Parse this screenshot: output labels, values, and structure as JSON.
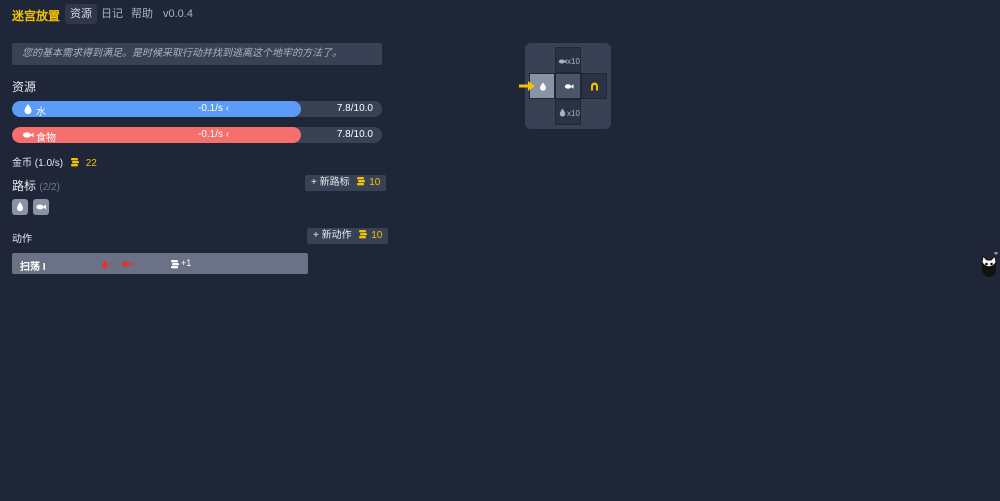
{
  "app": {
    "title": "迷宫放置"
  },
  "nav": [
    {
      "label": "资源",
      "active": true
    },
    {
      "label": "日记",
      "active": false
    },
    {
      "label": "帮助",
      "active": false
    },
    {
      "label": "v0.0.4",
      "active": false
    }
  ],
  "message": "您的基本需求得到满足。是时候采取行动并找到逃离这个地牢的方法了。",
  "resources": {
    "heading": "资源",
    "items": [
      {
        "name": "水",
        "icon": "water-drop-icon",
        "rate": "-0.1/s",
        "rate_icon": "chevron-left-icon",
        "amount": "7.8/10.0",
        "fraction": 0.78,
        "color": "#5a9cf8"
      },
      {
        "name": "食物",
        "icon": "fish-icon",
        "rate": "-0.1/s",
        "rate_icon": "chevron-left-icon",
        "amount": "7.8/10.0",
        "fraction": 0.78,
        "color": "#f56f6c"
      }
    ],
    "gold": {
      "label": "金币 (1.0/s)",
      "value": "22",
      "icon": "coin-stack-icon",
      "color": "#f2c200"
    }
  },
  "markers": {
    "heading": "路标",
    "count": "(2/2)",
    "new_button": {
      "plus": "+",
      "label": "新路标",
      "cost": "10",
      "cost_icon": "coin-stack-icon"
    },
    "items": [
      {
        "icon": "water-drop-icon"
      },
      {
        "icon": "fish-icon"
      }
    ]
  },
  "actions": {
    "heading": "动作",
    "new_button": {
      "plus": "+",
      "label": "新动作",
      "cost": "10",
      "cost_icon": "coin-stack-icon"
    },
    "items": [
      {
        "name": "扫荡 I",
        "costs": [
          {
            "icon": "water-drop-icon",
            "color": "#e0342f"
          },
          {
            "icon": "fish-icon",
            "color": "#e0342f"
          }
        ],
        "reward": "+1",
        "reward_icon": "coin-stack-icon"
      }
    ]
  },
  "minimap": {
    "top_label": "x10",
    "bottom_label": "x10",
    "pointer_icon": "arrow-right-icon",
    "pointer_color": "#f2c200",
    "east_icon": "exit-gate-icon"
  },
  "side": {
    "icon": "cat-avatar-icon"
  }
}
